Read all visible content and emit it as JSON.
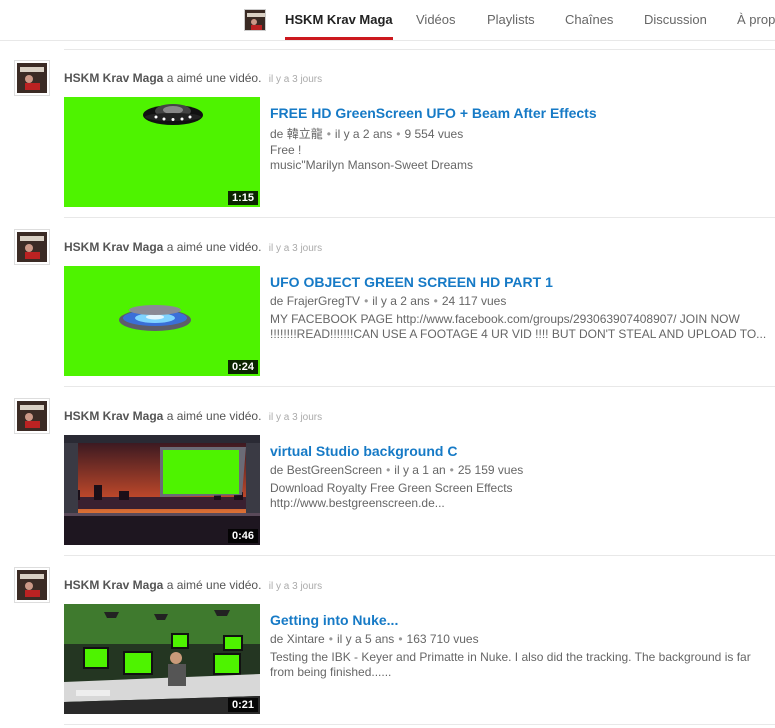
{
  "header": {
    "channel_name": "HSKM Krav Maga",
    "tabs": [
      {
        "label": "Vidéos"
      },
      {
        "label": "Playlists"
      },
      {
        "label": "Chaînes"
      },
      {
        "label": "Discussion"
      },
      {
        "label": "À propos"
      }
    ]
  },
  "feed": [
    {
      "author": "HSKM Krav Maga",
      "action": "a aimé une vidéo.",
      "time": "il y a 3 jours",
      "title": "FREE HD GreenScreen UFO + Beam After Effects",
      "by_prefix": "de",
      "uploader": "韓立龍",
      "age": "il y a 2 ans",
      "views": "9 554 vues",
      "duration": "1:15",
      "desc": [
        "Free !",
        "music\"Marilyn Manson-Sweet Dreams"
      ]
    },
    {
      "author": "HSKM Krav Maga",
      "action": "a aimé une vidéo.",
      "time": "il y a 3 jours",
      "title": "UFO OBJECT GREEN SCREEN HD PART 1",
      "by_prefix": "de",
      "uploader": "FrajerGregTV",
      "age": "il y a 2 ans",
      "views": "24 117 vues",
      "duration": "0:24",
      "desc": [
        "MY FACEBOOK PAGE http://www.facebook.com/groups/293063907408907/ JOIN NOW",
        "!!!!!!!!READ!!!!!!!CAN USE A FOOTAGE 4 UR VID !!!! BUT DON'T STEAL AND UPLOAD TO..."
      ]
    },
    {
      "author": "HSKM Krav Maga",
      "action": "a aimé une vidéo.",
      "time": "il y a 3 jours",
      "title": "virtual Studio background C",
      "by_prefix": "de",
      "uploader": "BestGreenScreen",
      "age": "il y a 1 an",
      "views": "25 159 vues",
      "duration": "0:46",
      "desc": [
        "Download Royalty Free Green Screen Effects",
        "http://www.bestgreenscreen.de..."
      ]
    },
    {
      "author": "HSKM Krav Maga",
      "action": "a aimé une vidéo.",
      "time": "il y a 3 jours",
      "title": "Getting into Nuke...",
      "by_prefix": "de",
      "uploader": "Xintare",
      "age": "il y a 5 ans",
      "views": "163 710 vues",
      "duration": "0:21",
      "desc": [
        "Testing the IBK - Keyer and Primatte in Nuke. I also did the tracking. The background is far",
        "from being finished......"
      ]
    }
  ],
  "colors": {
    "accent": "#cc181e",
    "link": "#167ac6",
    "green_screen": "#4ef300"
  }
}
